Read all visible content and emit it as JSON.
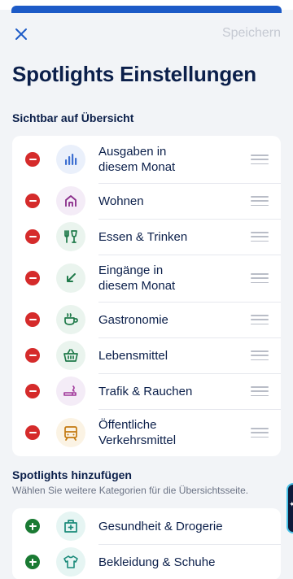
{
  "header": {
    "close_icon": "close-icon",
    "save_label": "Speichern"
  },
  "page": {
    "title": "Spotlights Einstellungen"
  },
  "visible_section": {
    "title": "Sichtbar auf Übersicht",
    "items": [
      {
        "label_line1": "Ausgaben in",
        "label_line2": "diesem Monat",
        "icon": "bar-chart-icon",
        "icon_bg": "#eaf0fb",
        "icon_color": "#3d6fd1"
      },
      {
        "label_line1": "Wohnen",
        "label_line2": "",
        "icon": "house-icon",
        "icon_bg": "#f4ecf7",
        "icon_color": "#8a2c8a"
      },
      {
        "label_line1": "Essen & Trinken",
        "label_line2": "",
        "icon": "fork-glass-icon",
        "icon_bg": "#eaf4ee",
        "icon_color": "#1f7a4a"
      },
      {
        "label_line1": "Eingänge in",
        "label_line2": "diesem Monat",
        "icon": "arrow-down-left-icon",
        "icon_bg": "#eaf4ee",
        "icon_color": "#1f7a4a"
      },
      {
        "label_line1": "Gastronomie",
        "label_line2": "",
        "icon": "coffee-cup-icon",
        "icon_bg": "#eaf4ee",
        "icon_color": "#1f7a4a"
      },
      {
        "label_line1": "Lebensmittel",
        "label_line2": "",
        "icon": "basket-icon",
        "icon_bg": "#eaf4ee",
        "icon_color": "#1f7a4a"
      },
      {
        "label_line1": "Trafik & Rauchen",
        "label_line2": "",
        "icon": "cigarette-icon",
        "icon_bg": "#f4ecf7",
        "icon_color": "#a0379a"
      },
      {
        "label_line1": "Öffentliche",
        "label_line2": "Verkehrsmittel",
        "icon": "tram-icon",
        "icon_bg": "#fbf3e4",
        "icon_color": "#c47a10"
      }
    ]
  },
  "add_section": {
    "title": "Spotlights hinzufügen",
    "subtitle": "Wählen Sie weitere Kategorien für die Übersichtsseite.",
    "items": [
      {
        "label_line1": "Gesundheit & Drogerie",
        "label_line2": "",
        "icon": "first-aid-kit-icon",
        "icon_bg": "#e6f5f3",
        "icon_color": "#1a8a7a"
      },
      {
        "label_line1": "Bekleidung & Schuhe",
        "label_line2": "",
        "icon": "shirt-icon",
        "icon_bg": "#e6f5f3",
        "icon_color": "#1a8a7a"
      }
    ]
  },
  "colors": {
    "remove": "#d52b2b",
    "add": "#1a7a33",
    "title": "#0b1f4a",
    "save_disabled": "#c5c9d2"
  }
}
